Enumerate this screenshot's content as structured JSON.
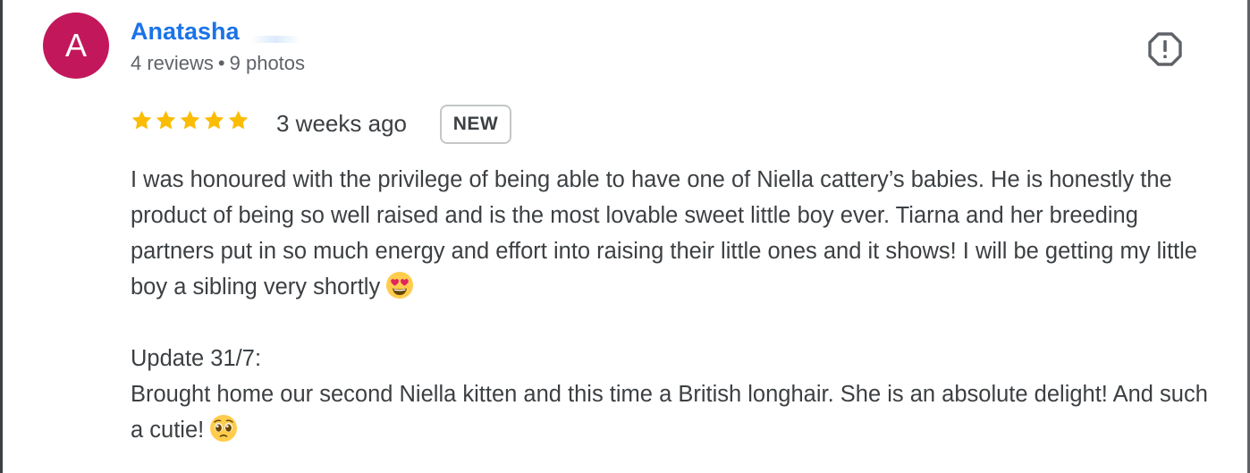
{
  "reviewer": {
    "avatar_letter": "A",
    "name": "Anatasha",
    "reviews_count": "4 reviews",
    "separator": "•",
    "photos_count": "9 photos"
  },
  "review": {
    "rating": 5,
    "rating_max": 5,
    "time_ago": "3 weeks ago",
    "badge": "NEW",
    "paragraph_1": "I was honoured with the privilege of being able to have one of Niella cattery’s babies. He is honestly the product of being so well raised and is the most lovable sweet little boy ever. Tiarna and her breeding partners put in so much energy and effort into raising their little ones and it shows! I will be getting my little boy a sibling very shortly",
    "paragraph_1_emoji": "heart-eyes-emoji",
    "update_heading": "Update 31/7:",
    "paragraph_2": "Brought home our second Niella kitten and this time a British longhair. She is an absolute delight! And such a cutie!",
    "paragraph_2_emoji": "pleading-face-emoji"
  },
  "icons": {
    "report": "report-flag-icon",
    "star": "star-icon"
  },
  "colors": {
    "avatar_bg": "#c2185b",
    "name": "#1a73e8",
    "star": "#fbbc04",
    "text": "#3c4043",
    "secondary_text": "#5f6368"
  }
}
